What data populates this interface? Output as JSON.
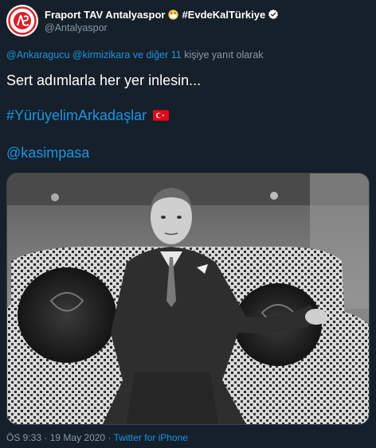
{
  "account": {
    "display_name_part1": "Fraport TAV Antalyaspor",
    "display_name_part2": "#EvdeKalTürkiye",
    "handle": "@Antalyaspor",
    "verified": true
  },
  "reply": {
    "mention1": "@Ankaragucu",
    "mention2": "@kirmizikara",
    "mention_separator": " ",
    "others": "ve diğer 11",
    "suffix": "kişiye yanıt olarak"
  },
  "tweet": {
    "text_line1": "Sert adımlarla her yer inlesin...",
    "hashtag": "#YürüyelimArkadaşlar",
    "mention": "@kasimpasa"
  },
  "meta": {
    "time": "ÖS 9:33",
    "separator": "·",
    "date": "19 May 2020",
    "separator2": "·",
    "source": "Twitter for iPhone"
  },
  "colors": {
    "background": "#15202b",
    "accent": "#1b95e0",
    "muted": "#8899a6",
    "flag_red": "#e30a17",
    "brand_red": "#d91f26"
  },
  "icons": {
    "avatar": "antalyaspor-logo",
    "emoji": "face-with-mask-emoji",
    "verified": "verified-badge-icon",
    "flag": "turkey-flag-emoji"
  }
}
